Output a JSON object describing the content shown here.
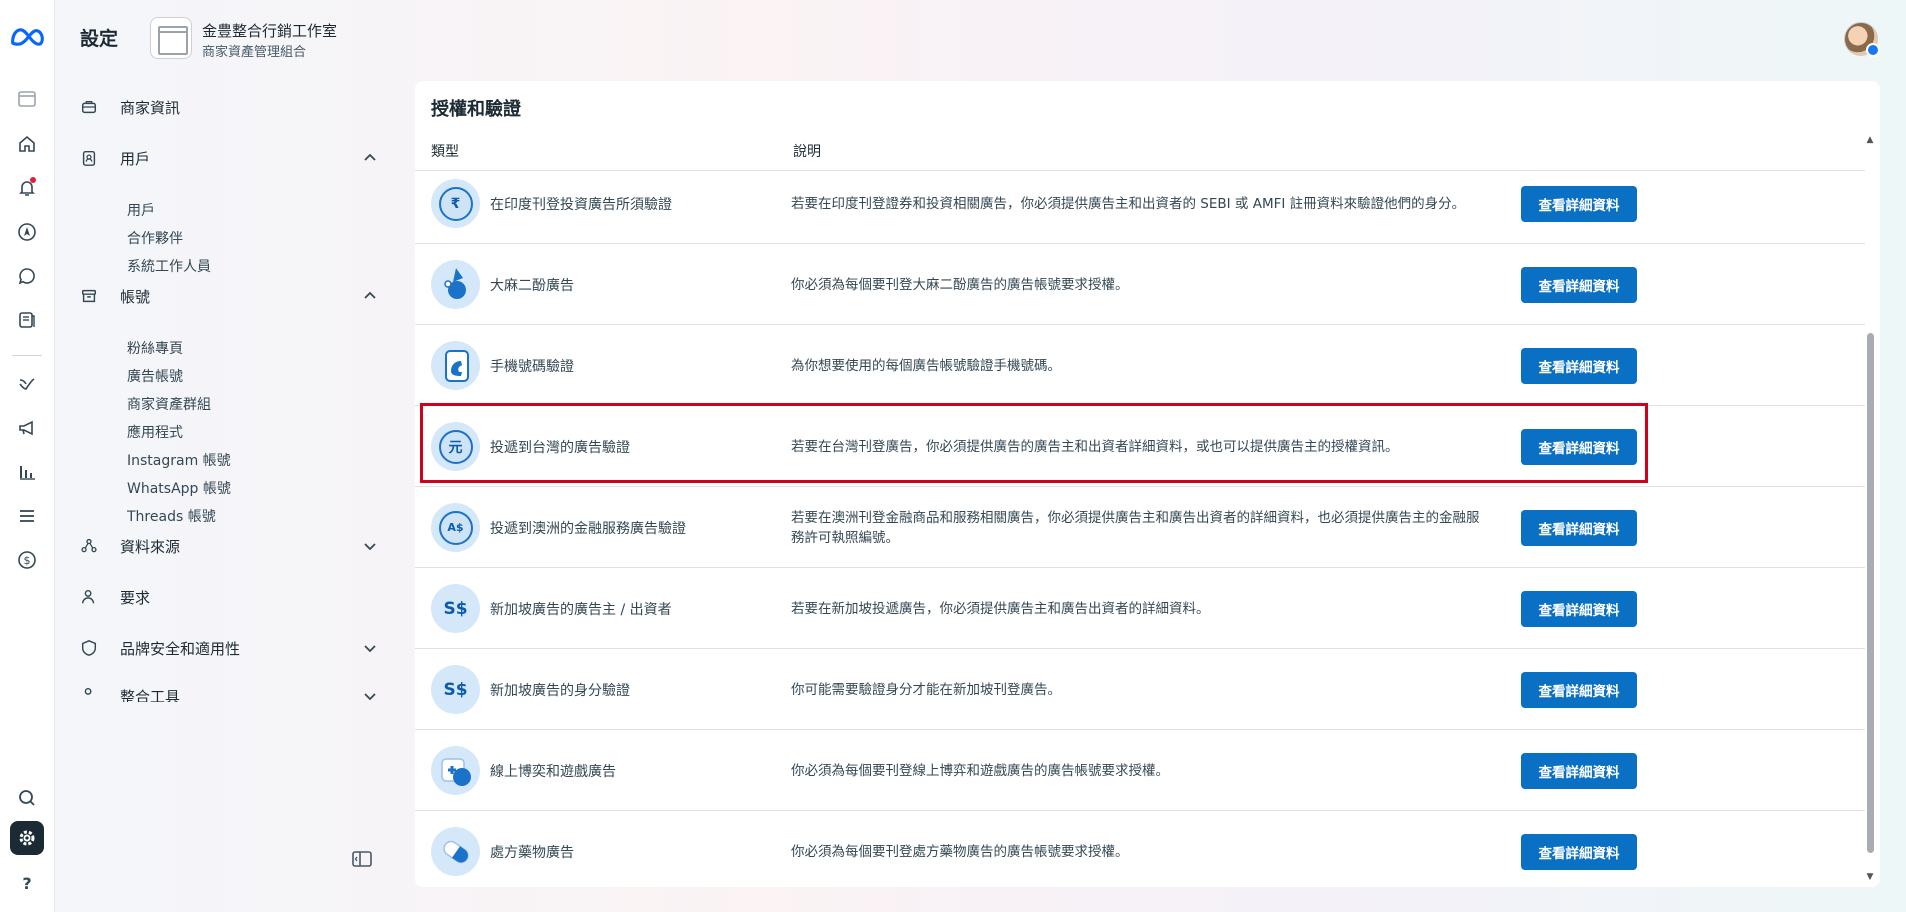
{
  "header": {
    "title": "設定",
    "business_name": "金豊整合行銷工作室",
    "business_subtitle": "商家資產管理組合"
  },
  "rail": {
    "icons": [
      "meta-logo-icon",
      "business-thumb-icon",
      "home-icon",
      "bell-icon",
      "compass-icon",
      "chat-icon",
      "pages-icon",
      "checkmark-icon",
      "megaphone-icon",
      "chart-bars-icon",
      "menu-icon",
      "dollar-icon",
      "search-icon",
      "settings-icon",
      "help-icon"
    ],
    "help_label": "?"
  },
  "sidebar": {
    "business_info": "商家資訊",
    "users": {
      "label": "用戶",
      "items": [
        "用戶",
        "合作夥伴",
        "系統工作人員"
      ]
    },
    "accounts": {
      "label": "帳號",
      "items": [
        "粉絲專頁",
        "廣告帳號",
        "商家資產群組",
        "應用程式",
        "Instagram 帳號",
        "WhatsApp 帳號",
        "Threads 帳號"
      ]
    },
    "data_sources": "資料來源",
    "requests": "要求",
    "brand_safety": "品牌安全和適用性",
    "integrations": "整合工具"
  },
  "panel": {
    "title": "授權和驗證",
    "col_type": "類型",
    "col_desc": "說明",
    "button_label": "查看詳細資料",
    "rows": [
      {
        "type": "在印度刊登投資廣告所須驗證",
        "desc": "若要在印度刊登證券和投資相關廣告，你必須提供廣告主和出資者的 SEBI 或 AMFI 註冊資料來驗證他們的身分。",
        "icon": "rupee-icon",
        "glyph": "₹"
      },
      {
        "type": "大麻二酚廣告",
        "desc": "你必須為每個要刊登大麻二酚廣告的廣告帳號要求授權。",
        "icon": "cbd-icon",
        "glyph": ""
      },
      {
        "type": "手機號碼驗證",
        "desc": "為你想要使用的每個廣告帳號驗證手機號碼。",
        "icon": "phone-icon",
        "glyph": ""
      },
      {
        "type": "投遞到台灣的廣告驗證",
        "desc": "若要在台灣刊登廣告，你必須提供廣告的廣告主和出資者詳細資料，或也可以提供廣告主的授權資訊。",
        "icon": "yuan-icon",
        "glyph": "元"
      },
      {
        "type": "投遞到澳洲的金融服務廣告驗證",
        "desc": "若要在澳洲刊登金融商品和服務相關廣告，你必須提供廣告主和廣告出資者的詳細資料，也必須提供廣告主的金融服務許可執照編號。",
        "icon": "aud-icon",
        "glyph": "A$"
      },
      {
        "type": "新加坡廣告的廣告主 / 出資者",
        "desc": "若要在新加坡投遞廣告，你必須提供廣告主和廣告出資者的詳細資料。",
        "icon": "sgd-icon",
        "glyph": "S$"
      },
      {
        "type": "新加坡廣告的身分驗證",
        "desc": "你可能需要驗證身分才能在新加坡刊登廣告。",
        "icon": "sgd-icon",
        "glyph": "S$"
      },
      {
        "type": "線上博奕和遊戲廣告",
        "desc": "你必須為每個要刊登線上博弈和遊戲廣告的廣告帳號要求授權。",
        "icon": "gaming-icon",
        "glyph": ""
      },
      {
        "type": "處方藥物廣告",
        "desc": "你必須為每個要刊登處方藥物廣告的廣告帳號要求授權。",
        "icon": "pill-icon",
        "glyph": ""
      }
    ]
  }
}
